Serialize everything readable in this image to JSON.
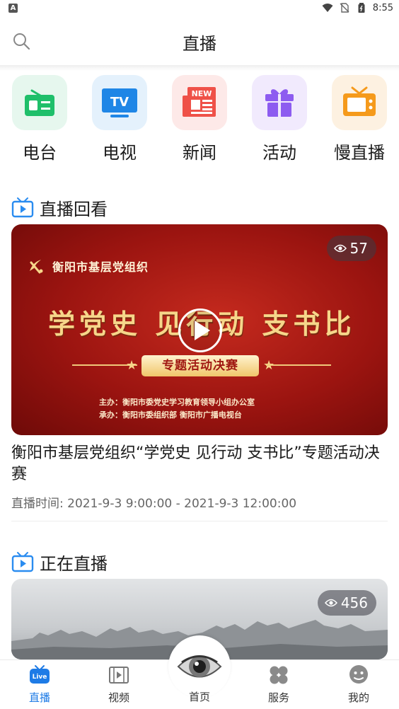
{
  "status_bar": {
    "time": "8:55",
    "left_badge": "A"
  },
  "header": {
    "title": "直播"
  },
  "categories": [
    {
      "label": "电台",
      "icon": "radio-icon",
      "color": "#1fbf6a",
      "bg": "#e6f7ee"
    },
    {
      "label": "电视",
      "icon": "tv-icon",
      "color": "#1f86e6",
      "bg": "#e4f1fc"
    },
    {
      "label": "新闻",
      "icon": "newspaper-icon",
      "color": "#ef5148",
      "bg": "#fde9e8",
      "badge": "NEW"
    },
    {
      "label": "活动",
      "icon": "gift-icon",
      "color": "#8d5cf0",
      "bg": "#f1eafd"
    },
    {
      "label": "慢直播",
      "icon": "retro-tv-icon",
      "color": "#f59a1b",
      "bg": "#fdf1e1"
    }
  ],
  "replay_section": {
    "title": "直播回看",
    "views": "57",
    "poster": {
      "org": "衡阳市基层党组织",
      "headline": "学党史 见行动 支书比",
      "tag": "专题活动决赛",
      "credit1": "主办：衡阳市委党史学习教育领导小组办公室",
      "credit2": "承办：衡阳市委组织部      衡阳市广播电视台"
    },
    "item_title": "衡阳市基层党组织“学党史 见行动  支书比”专题活动决赛",
    "item_time": "直播时间: 2021-9-3 9:00:00 - 2021-9-3 12:00:00"
  },
  "live_section": {
    "title": "正在直播",
    "views": "456"
  },
  "tabbar": {
    "tabs": [
      {
        "label": "直播",
        "icon": "live-icon",
        "active": true
      },
      {
        "label": "视频",
        "icon": "film-icon",
        "active": false
      },
      {
        "label": "首页",
        "icon": "home-eye-icon",
        "active": false
      },
      {
        "label": "服务",
        "icon": "clover-icon",
        "active": false
      },
      {
        "label": "我的",
        "icon": "profile-icon",
        "active": false
      }
    ],
    "live_badge": "Live"
  },
  "colors": {
    "accent": "#1e7be6",
    "section_icon": "#2a8cf0"
  }
}
